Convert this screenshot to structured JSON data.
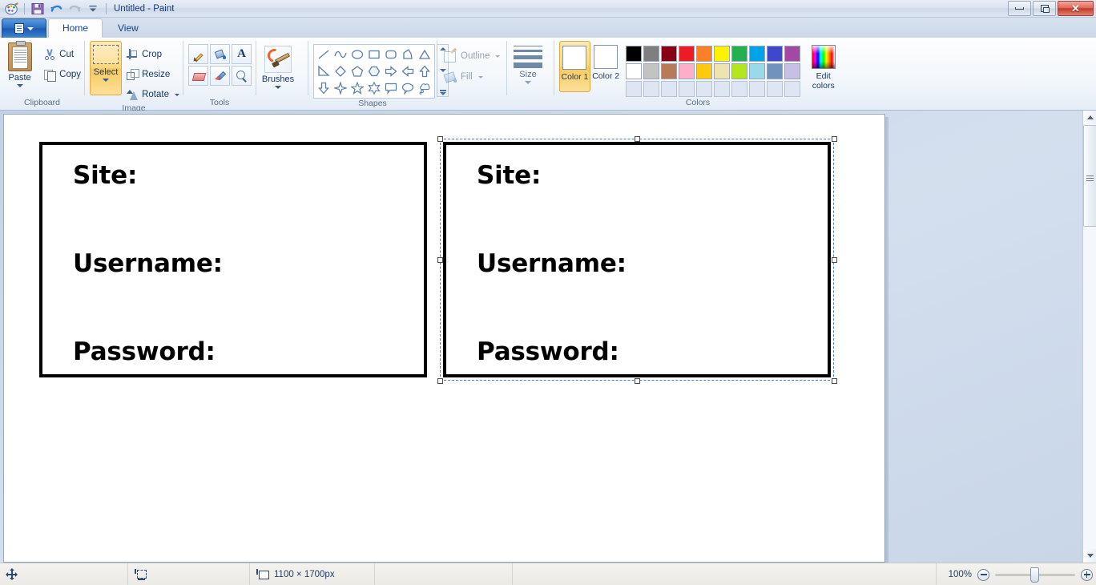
{
  "window": {
    "title": "Untitled - Paint",
    "quick_access": [
      {
        "name": "paint-app-icon",
        "label": "Paint"
      },
      {
        "name": "save-icon",
        "label": "Save"
      },
      {
        "name": "undo-icon",
        "label": "Undo"
      },
      {
        "name": "redo-icon",
        "label": "Redo"
      },
      {
        "name": "customize-qat-icon",
        "label": "Customize Quick Access Toolbar"
      }
    ],
    "controls": [
      {
        "name": "minimize-button",
        "label": "Minimize"
      },
      {
        "name": "restore-button",
        "label": "Restore Down"
      },
      {
        "name": "close-button",
        "label": "Close"
      }
    ]
  },
  "tabs": {
    "menu_button_label": "File",
    "items": [
      {
        "label": "Home",
        "active": true
      },
      {
        "label": "View",
        "active": false
      }
    ]
  },
  "ribbon": {
    "clipboard": {
      "group_label": "Clipboard",
      "paste_label": "Paste",
      "cut_label": "Cut",
      "copy_label": "Copy"
    },
    "image": {
      "group_label": "Image",
      "select_label": "Select",
      "crop_label": "Crop",
      "resize_label": "Resize",
      "rotate_label": "Rotate"
    },
    "tools": {
      "group_label": "Tools",
      "items": [
        {
          "name": "pencil-tool",
          "label": "Pencil"
        },
        {
          "name": "fill-tool",
          "label": "Fill with color"
        },
        {
          "name": "text-tool",
          "label": "Text"
        },
        {
          "name": "eraser-tool",
          "label": "Eraser"
        },
        {
          "name": "color-picker-tool",
          "label": "Color picker"
        },
        {
          "name": "magnifier-tool",
          "label": "Magnifier"
        }
      ]
    },
    "brushes": {
      "label": "Brushes"
    },
    "shapes": {
      "group_label": "Shapes",
      "items": [
        "line",
        "curve",
        "oval",
        "rectangle",
        "rounded-rectangle",
        "polygon",
        "triangle",
        "right-triangle",
        "diamond",
        "pentagon",
        "hexagon",
        "right-arrow",
        "left-arrow",
        "up-arrow",
        "down-arrow",
        "four-point-star",
        "five-point-star",
        "six-point-star",
        "rectangular-callout",
        "oval-callout",
        "cloud-callout"
      ]
    },
    "style": {
      "outline_label": "Outline",
      "fill_label": "Fill",
      "outline_enabled": false,
      "fill_enabled": false
    },
    "size": {
      "label": "Size",
      "weights": [
        1,
        3,
        5,
        7
      ]
    },
    "colors": {
      "group_label": "Colors",
      "color1_label": "Color 1",
      "color2_label": "Color 2",
      "color1_value": "#ffffff",
      "color2_value": "#ffffff",
      "edit_colors_label_line1": "Edit",
      "edit_colors_label_line2": "colors",
      "row1": [
        "#000000",
        "#7f7f7f",
        "#880015",
        "#ed1c24",
        "#ff7f27",
        "#fff200",
        "#22b14c",
        "#00a2e8",
        "#3f48cc",
        "#a349a4"
      ],
      "row2": [
        "#ffffff",
        "#c3c3c3",
        "#b97a57",
        "#ffaec9",
        "#ffc90e",
        "#efe4b0",
        "#b5e61d",
        "#99d9ea",
        "#7092be",
        "#c8bfe7"
      ],
      "row3_empty_count": 10
    }
  },
  "canvas": {
    "boxes": [
      {
        "name": "password-form-box-left",
        "selected": false,
        "labels": [
          "Site:",
          "Username:",
          "Password:"
        ]
      },
      {
        "name": "password-form-box-right",
        "selected": true,
        "labels": [
          "Site:",
          "Username:",
          "Password:"
        ]
      }
    ]
  },
  "statusbar": {
    "cursor_position": "",
    "selection_size": "",
    "image_size": "1100 × 1700px",
    "zoom_level": "100%",
    "zoom_out_label": "Zoom out",
    "zoom_in_label": "Zoom in"
  }
}
